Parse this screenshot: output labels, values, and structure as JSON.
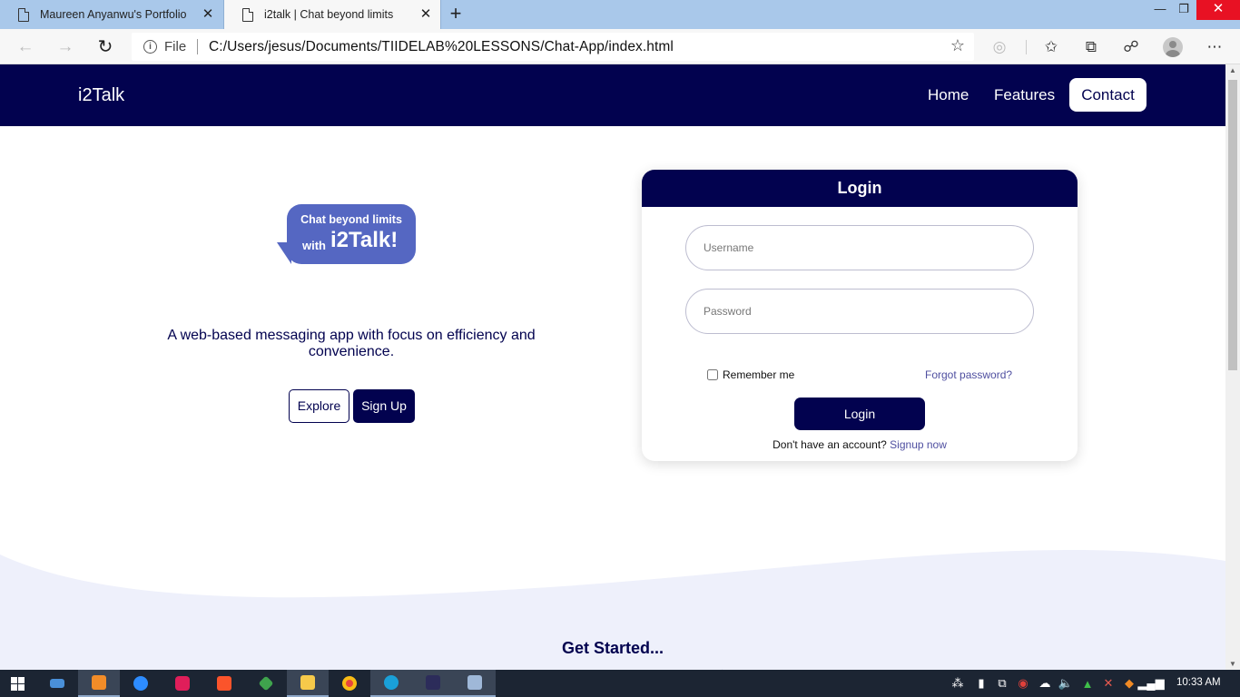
{
  "browser": {
    "tabs": [
      {
        "title": "Maureen Anyanwu's Portfolio",
        "active": false
      },
      {
        "title": "i2talk | Chat beyond limits",
        "active": true
      }
    ],
    "new_tab_icon": "+",
    "address": {
      "scheme_label": "File",
      "url": "C:/Users/jesus/Documents/TIIDELAB%20LESSONS/Chat-App/index.html"
    }
  },
  "site": {
    "brand": "i2Talk",
    "nav": {
      "home": "Home",
      "features": "Features",
      "contact": "Contact"
    },
    "hero": {
      "bubble_line1": "Chat beyond limits",
      "bubble_with": "with",
      "bubble_brand": "i2Talk!",
      "tagline": "A web-based messaging app with focus on efficiency and convenience.",
      "explore_label": "Explore",
      "signup_label": "Sign Up"
    },
    "login": {
      "title": "Login",
      "username_placeholder": "Username",
      "password_placeholder": "Password",
      "remember_label": "Remember me",
      "forgot_label": "Forgot password?",
      "submit_label": "Login",
      "no_account_text": "Don't have an account?",
      "signup_link": "Signup now"
    },
    "get_started": "Get Started..."
  },
  "taskbar": {
    "clock": "10:33 AM"
  },
  "colors": {
    "navy": "#02024f",
    "bubble": "#5567c2",
    "link": "#4f4fa0",
    "wave": "#eef0fb"
  }
}
